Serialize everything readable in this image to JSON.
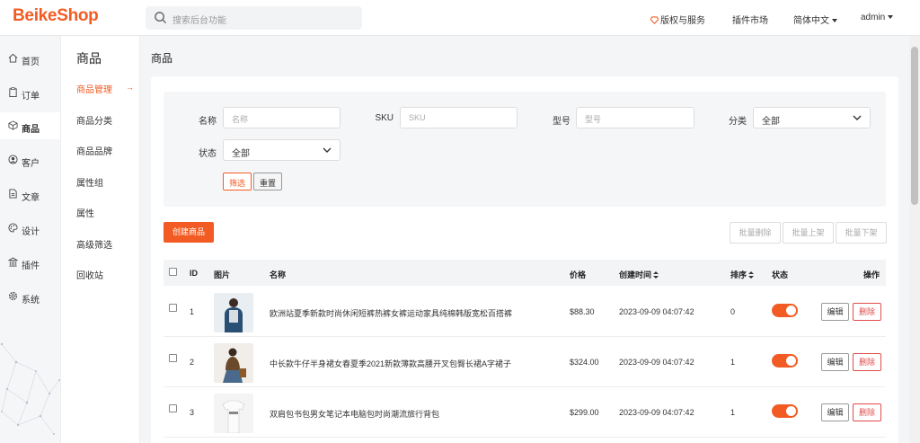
{
  "header": {
    "logo": "BeikeShop",
    "search_placeholder": "搜索后台功能",
    "copyright": "版权与服务",
    "plugin_market": "插件市场",
    "language": "简体中文",
    "user": "admin",
    "accent": "#f25c24"
  },
  "sidebar": {
    "items": [
      {
        "label": "首页",
        "icon": "home-icon"
      },
      {
        "label": "订单",
        "icon": "clipboard-icon"
      },
      {
        "label": "商品",
        "icon": "box-icon"
      },
      {
        "label": "客户",
        "icon": "user-circle-icon"
      },
      {
        "label": "文章",
        "icon": "document-icon"
      },
      {
        "label": "设计",
        "icon": "palette-icon"
      },
      {
        "label": "插件",
        "icon": "bank-icon"
      },
      {
        "label": "系统",
        "icon": "gear-icon"
      }
    ]
  },
  "subnav": {
    "title": "商品",
    "items": [
      "商品管理",
      "商品分类",
      "商品品牌",
      "属性组",
      "属性",
      "高级筛选",
      "回收站"
    ],
    "arrow": "→"
  },
  "page": {
    "title": "商品"
  },
  "filter": {
    "name_label": "名称",
    "name_placeholder": "名称",
    "sku_label": "SKU",
    "sku_placeholder": "SKU",
    "model_label": "型号",
    "model_placeholder": "型号",
    "category_label": "分类",
    "category_value": "全部",
    "status_label": "状态",
    "status_value": "全部",
    "filter_button": "筛选",
    "reset_button": "重置"
  },
  "actions": {
    "create": "创建商品",
    "bulk_delete": "批量删除",
    "bulk_on": "批量上架",
    "bulk_off": "批量下架"
  },
  "table": {
    "headers": {
      "id": "ID",
      "image": "图片",
      "name": "名称",
      "price": "价格",
      "created": "创建时间",
      "sort": "排序",
      "status": "状态",
      "ops": "操作"
    },
    "rows": [
      {
        "id": "1",
        "name": "欧洲站夏季新款时尚休闲短裤热裤女裤运动家具纯棉韩版宽松百搭裤",
        "price": "$88.30",
        "created": "2023-09-09 04:07:42",
        "sort": "0",
        "enabled": true,
        "edit": "编辑",
        "delete": "删除"
      },
      {
        "id": "2",
        "name": "中长款牛仔半身裙女春夏季2021新款薄款高腰开叉包臀长裙A字裙子",
        "price": "$324.00",
        "created": "2023-09-09 04:07:42",
        "sort": "1",
        "enabled": true,
        "edit": "编辑",
        "delete": "删除"
      },
      {
        "id": "3",
        "name": "双肩包书包男女笔记本电脑包时尚潮流旅行背包",
        "price": "$299.00",
        "created": "2023-09-09 04:07:42",
        "sort": "1",
        "enabled": true,
        "edit": "编辑",
        "delete": "删除"
      }
    ]
  }
}
